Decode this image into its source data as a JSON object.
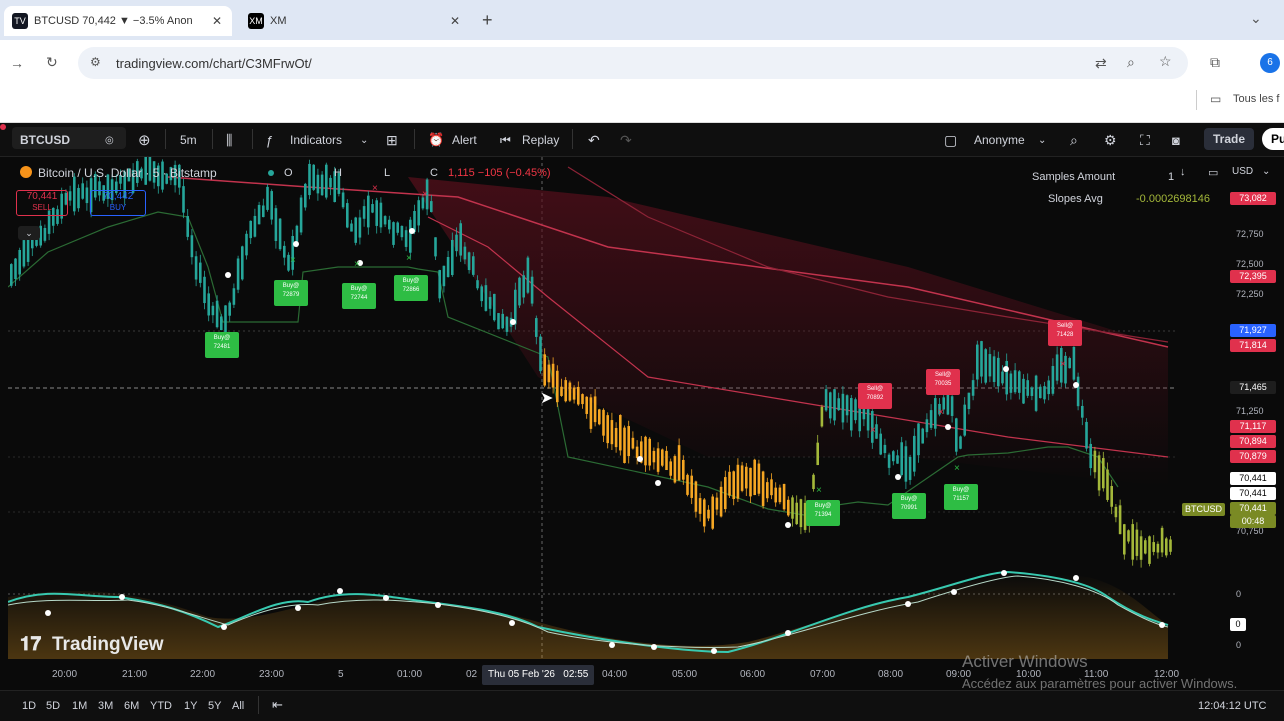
{
  "browser": {
    "tabs": [
      {
        "title": "BTCUSD 70,442 ▼ −3.5% Anon",
        "favicon": "TV"
      },
      {
        "title": "XM",
        "favicon": "XM"
      }
    ],
    "url": "tradingview.com/chart/C3MFrwOt/",
    "bookmark": "Tous les f",
    "profile_initial": "6"
  },
  "toolbar": {
    "symbol": "BTCUSD",
    "interval": "5m",
    "indicators": "Indicators",
    "alert": "Alert",
    "replay": "Replay",
    "account": "Anonyme",
    "trade": "Trade",
    "publish": "Pu"
  },
  "legend": {
    "title": "Bitcoin / U.S. Dollar · 5 · Bitstamp",
    "open": "O",
    "high": "H",
    "low": "L",
    "close": "C",
    "change": "1,115 −105 (−0.45%)",
    "sell_price": "70,441",
    "sell_label": "SELL",
    "buy_price": "70,442",
    "buy_label": "BUY"
  },
  "indicator_table": {
    "row1_label": "Samples Amount",
    "row1_value": "1",
    "row2_label": "Slopes Avg",
    "row2_value": "-0.0002698146"
  },
  "price_scale": {
    "currency": "USD",
    "ticks": [
      "72,750",
      "72,500",
      "72,250",
      "71,250",
      "70,750"
    ],
    "labels": [
      {
        "text": "73,082",
        "color": "#e0314d"
      },
      {
        "text": "72,395",
        "color": "#e0314d"
      },
      {
        "text": "71,927",
        "color": "#2962ff"
      },
      {
        "text": "71,814",
        "color": "#e0314d"
      },
      {
        "text": "71,465",
        "color": "#1e1e1e"
      },
      {
        "text": "71,117",
        "color": "#e0314d"
      },
      {
        "text": "70,894",
        "color": "#e0314d"
      },
      {
        "text": "70,879",
        "color": "#e0314d"
      },
      {
        "text": "70,441",
        "color": "#ffffff"
      },
      {
        "text": "70,441",
        "color": "#ffffff"
      },
      {
        "text": "70,441",
        "color": "#7a8a24"
      },
      {
        "text": "00:48",
        "color": "#7a8a24"
      }
    ],
    "symbol_tag": "BTCUSD",
    "osc_zero": "0",
    "osc_label": "0"
  },
  "signals": {
    "buy": [
      {
        "label": "Buy@",
        "price": "72481"
      },
      {
        "label": "Buy@",
        "price": "72879"
      },
      {
        "label": "Buy@",
        "price": "72744"
      },
      {
        "label": "Buy@",
        "price": "72866"
      },
      {
        "label": "Buy@",
        "price": "71394"
      },
      {
        "label": "Buy@",
        "price": "70991"
      },
      {
        "label": "Buy@",
        "price": "71157"
      }
    ],
    "sell": [
      {
        "label": "Sell@",
        "price": "70892"
      },
      {
        "label": "Sell@",
        "price": "70035"
      },
      {
        "label": "Sell@",
        "price": "71428"
      }
    ]
  },
  "time_axis": {
    "ticks": [
      "20:00",
      "21:00",
      "22:00",
      "23:00",
      "5",
      "01:00",
      "02",
      "04:00",
      "05:00",
      "06:00",
      "07:00",
      "08:00",
      "09:00",
      "10:00",
      "11:00",
      "12:00"
    ],
    "crosshair": "Thu 05 Feb '26   02:55"
  },
  "watermark": "TradingView",
  "windows_activation": {
    "title": "Activer Windows",
    "subtitle": "Accédez aux paramètres pour activer Windows."
  },
  "bottom": {
    "ranges": [
      "1D",
      "5D",
      "1M",
      "3M",
      "6M",
      "YTD",
      "1Y",
      "5Y",
      "All"
    ],
    "clock": "12:04:12 UTC"
  },
  "colors": {
    "bull": "#26a69a",
    "bear_orange": "#f5a623",
    "olive": "#a4b83a",
    "ma_red": "#c2334d",
    "buy": "#2ebd44",
    "sell": "#e0314d"
  }
}
